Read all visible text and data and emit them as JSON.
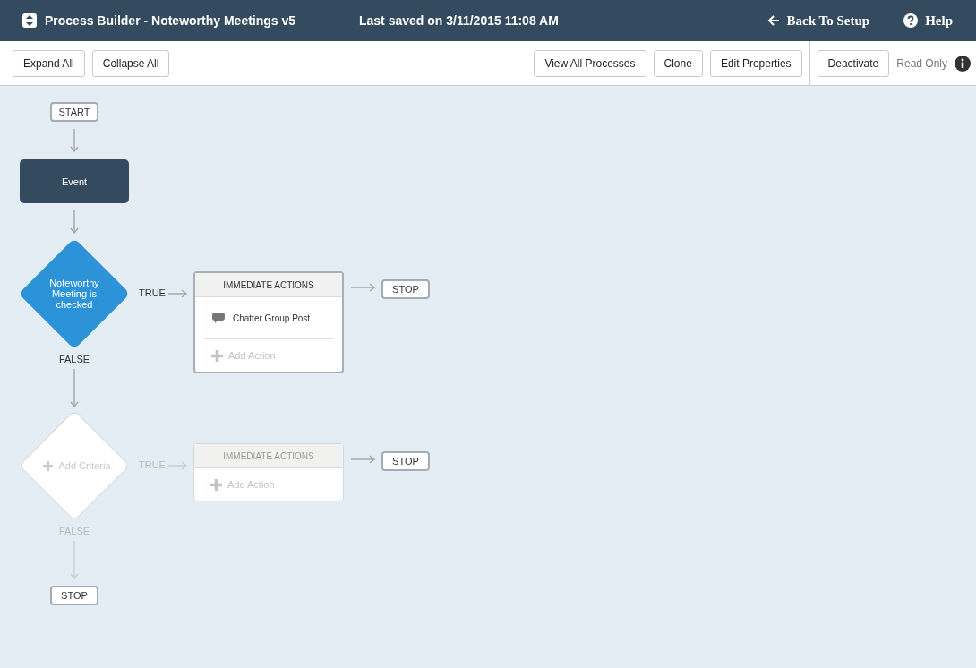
{
  "header": {
    "title": "Process Builder - Noteworthy Meetings v5",
    "saved": "Last saved on 3/11/2015 11:08 AM",
    "back": "Back To Setup",
    "help": "Help"
  },
  "toolbar": {
    "left": [
      "Expand All",
      "Collapse All"
    ],
    "right": [
      "View All Processes",
      "Clone",
      "Edit Properties"
    ],
    "status_button": "Deactivate",
    "status": "Read Only"
  },
  "canvas": {
    "start": "START",
    "event": "Event",
    "criteria": [
      {
        "kind": "defined",
        "label": "Noteworthy Meeting is checked",
        "true_label": "TRUE",
        "false_label": "FALSE",
        "actions_header": "IMMEDIATE ACTIONS",
        "actions": [
          "Chatter Group Post"
        ],
        "add_action": "Add Action",
        "stop": "STOP"
      },
      {
        "kind": "placeholder",
        "label": "Add Criteria",
        "true_label": "TRUE",
        "false_label": "FALSE",
        "actions_header": "IMMEDIATE ACTIONS",
        "add_action": "Add Action",
        "stop": "STOP"
      }
    ],
    "end": "STOP"
  }
}
